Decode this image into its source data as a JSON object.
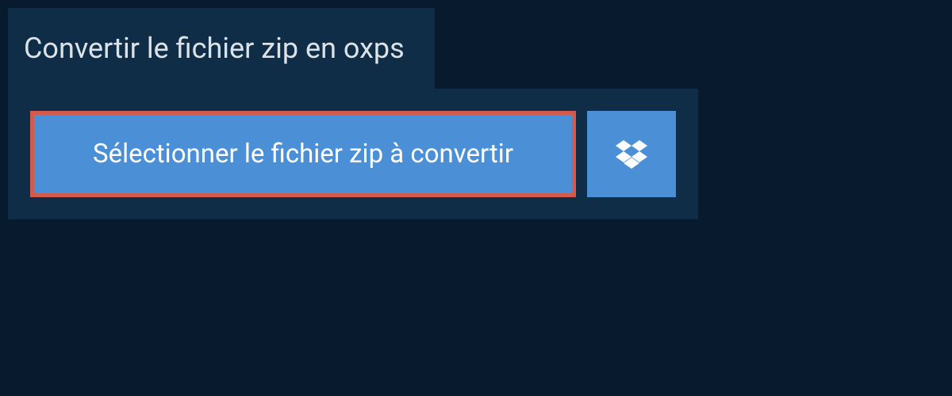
{
  "title": "Convertir le fichier zip en oxps",
  "select_button_label": "Sélectionner le fichier zip à convertir"
}
